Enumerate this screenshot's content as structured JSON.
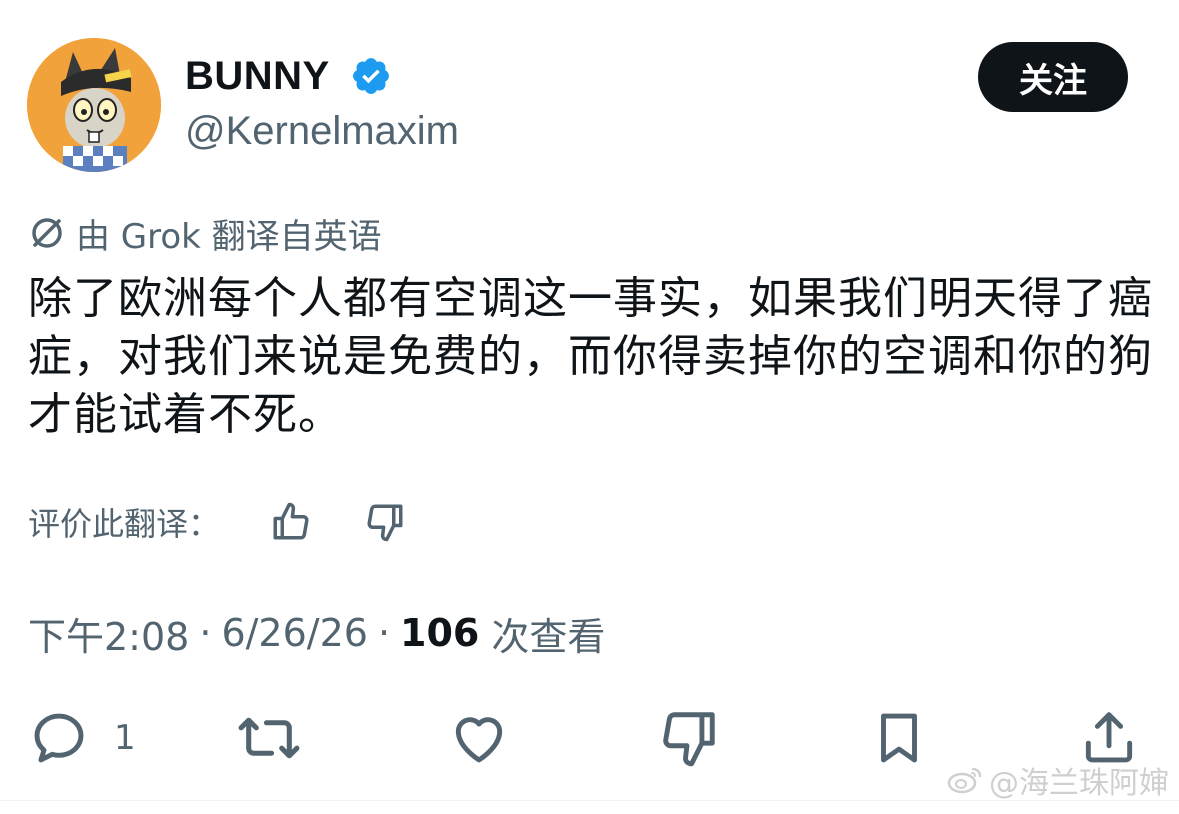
{
  "author": {
    "display_name": "BUNNY",
    "handle": "@Kernelmaxim",
    "verified": true,
    "avatar_icon": "cartoon-rabbit-avatar"
  },
  "follow_button": {
    "label": "关注"
  },
  "translation": {
    "note": "由 Grok 翻译自英语",
    "icon": "translate-icon"
  },
  "tweet": {
    "text": "除了欧洲每个人都有空调这一事实，如果我们明天得了癌症，对我们来说是免费的，而你得卖掉你的空调和你的狗才能试着不死。"
  },
  "rate_translation": {
    "label": "评价此翻译：",
    "up_icon": "thumbs-up-icon",
    "down_icon": "thumbs-down-icon"
  },
  "meta": {
    "time": "下午2:08",
    "separator": "·",
    "date": "6/26/26",
    "views_count": "106",
    "views_label": "次查看"
  },
  "actions": {
    "reply_count": "1",
    "icons": [
      "reply-icon",
      "retweet-icon",
      "like-icon",
      "dislike-icon",
      "bookmark-icon",
      "share-icon"
    ]
  },
  "watermark": {
    "text": "@海兰珠阿婶",
    "icon": "weibo-icon"
  },
  "colors": {
    "text": "#0f1419",
    "secondary": "#536471",
    "verified": "#1d9bf0",
    "button_bg": "#0f1419",
    "avatar_bg": "#f2a23a"
  }
}
